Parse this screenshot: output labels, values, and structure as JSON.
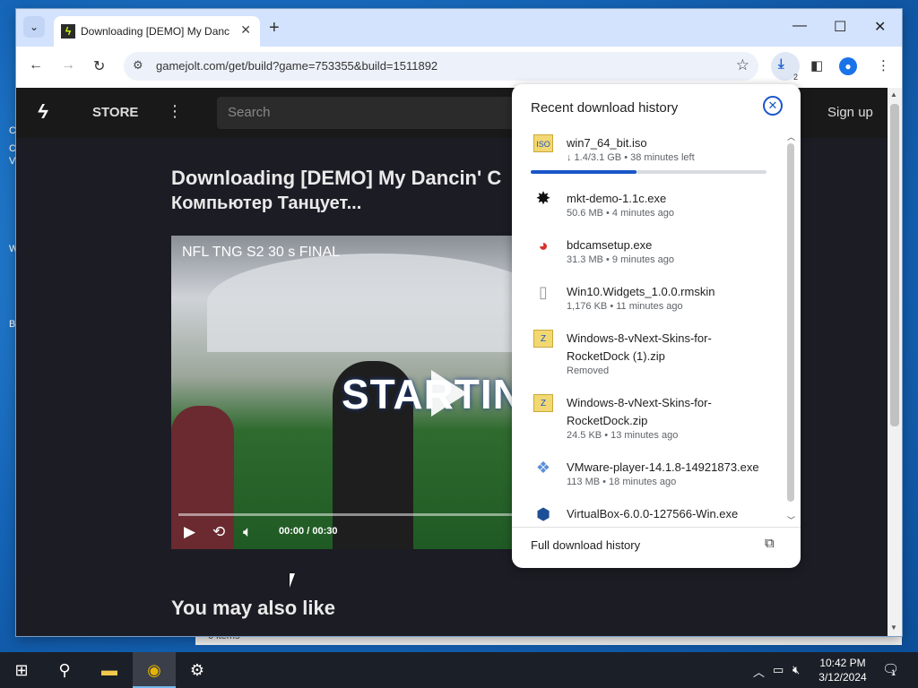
{
  "browser": {
    "tab_title": "Downloading [DEMO] My Dancin' Computer",
    "tab_search_icon": "chevron-down-icon",
    "new_tab": "+",
    "url": "gamejolt.com/get/build?game=753355&build=1511892",
    "download_count": "2",
    "window_controls": {
      "minimize": "—",
      "maximize": "☐",
      "close": "✕"
    }
  },
  "site": {
    "store_label": "STORE",
    "search_placeholder": "Search",
    "signup_label": "Sign up",
    "heading_line1": "Downloading [DEMO] My Dancin' C",
    "heading_line2": "Компьютер Танцует...",
    "video_title": "NFL TNG S2 30 s FINAL",
    "video_brand": "STARTING",
    "video_time_current": "00:00",
    "video_time_sep": "/",
    "video_time_total": "00:30",
    "also_like": "You may also like"
  },
  "downloads": {
    "title": "Recent download history",
    "footer": "Full download history",
    "items": [
      {
        "name": "win7_64_bit.iso",
        "meta": "↓ 1.4/3.1 GB • 38 minutes left",
        "icon": "iso-file-icon",
        "progress": 0.45
      },
      {
        "name": "mkt-demo-1.1c.exe",
        "meta": "50.6 MB • 4 minutes ago",
        "icon": "exe-file-icon"
      },
      {
        "name": "bdcamsetup.exe",
        "meta": "31.3 MB • 9 minutes ago",
        "icon": "bandicam-icon"
      },
      {
        "name": "Win10.Widgets_1.0.0.rmskin",
        "meta": "1,176 KB • 11 minutes ago",
        "icon": "generic-file-icon"
      },
      {
        "name": "Windows-8-vNext-Skins-for-RocketDock (1).zip",
        "meta": "Removed",
        "icon": "zip-file-icon"
      },
      {
        "name": "Windows-8-vNext-Skins-for-RocketDock.zip",
        "meta": "24.5 KB • 13 minutes ago",
        "icon": "zip-file-icon"
      },
      {
        "name": "VMware-player-14.1.8-14921873.exe",
        "meta": "113 MB • 18 minutes ago",
        "icon": "vmware-icon"
      },
      {
        "name": "VirtualBox-6.0.0-127566-Win.exe",
        "meta": "",
        "icon": "virtualbox-icon"
      }
    ]
  },
  "behind": {
    "status_text": "0 items"
  },
  "taskbar": {
    "time": "10:42 PM",
    "date": "3/12/2024",
    "notification_count": "1"
  },
  "colors": {
    "accent": "#1a56c8",
    "page_bg": "#1c1c24",
    "tabstrip": "#d3e3fd"
  }
}
